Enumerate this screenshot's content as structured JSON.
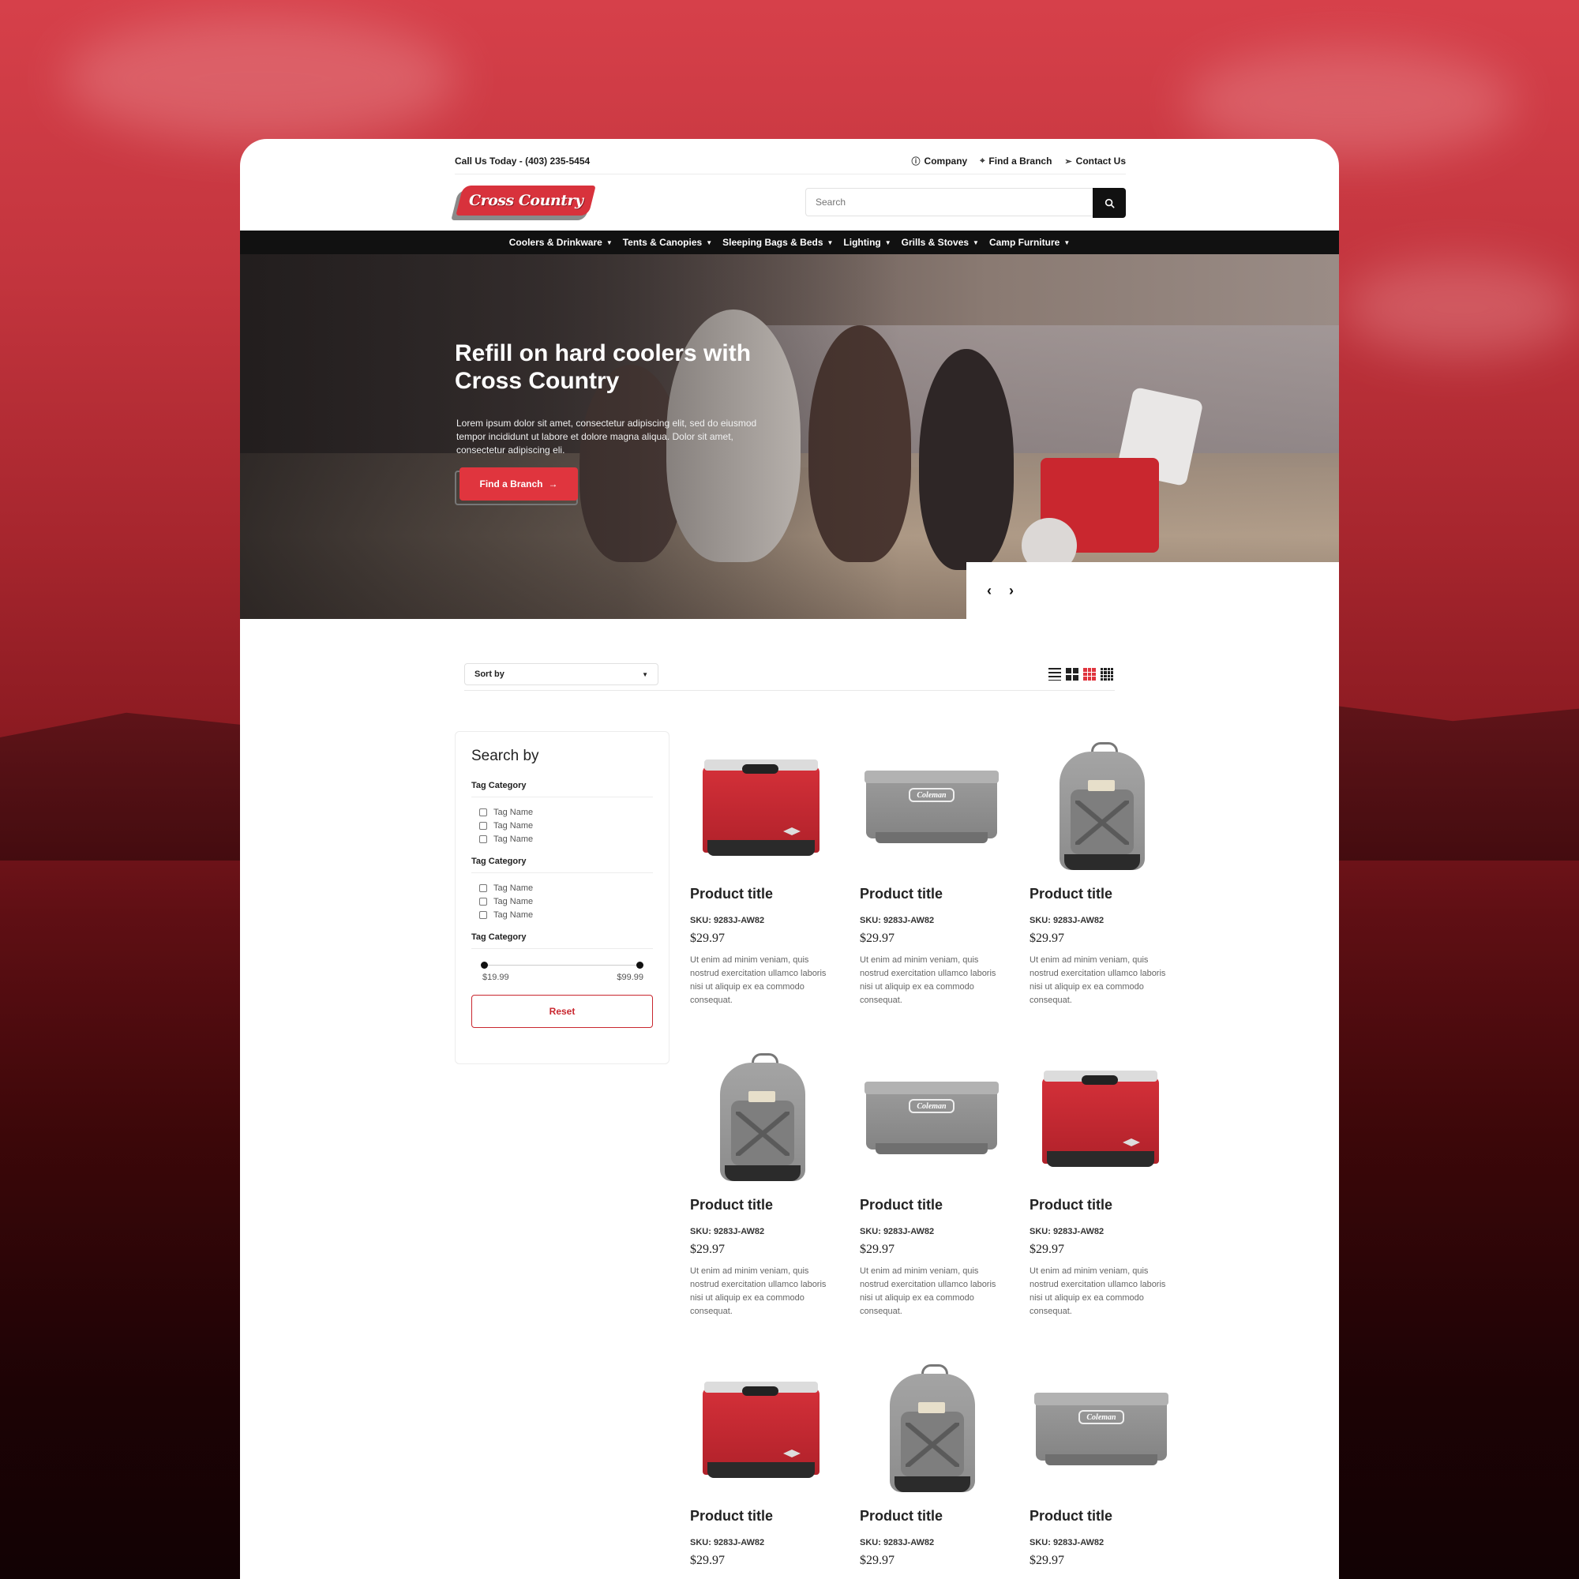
{
  "topbar": {
    "phone": "Call Us Today - (403) 235-5454",
    "links": [
      {
        "icon": "info-icon",
        "label": "Company"
      },
      {
        "icon": "map-pin-icon",
        "label": "Find a Branch"
      },
      {
        "icon": "send-icon",
        "label": "Contact Us"
      }
    ]
  },
  "header": {
    "logo_text": "Cross Country",
    "search_placeholder": "Search",
    "search_icon": "search-icon"
  },
  "nav": {
    "items": [
      "Coolers & Drinkware",
      "Tents & Canopies",
      "Sleeping Bags & Beds",
      "Lighting",
      "Grills & Stoves",
      "Camp Furniture"
    ]
  },
  "hero": {
    "title": "Refill on hard coolers with Cross Country",
    "text": "Lorem ipsum dolor sit amet, consectetur adipiscing elit, sed do eiusmod tempor incididunt ut labore et dolore magna aliqua. Dolor sit amet, consectetur adipiscing eli.",
    "button_label": "Find a Branch",
    "prev_icon": "chevron-left-icon",
    "next_icon": "chevron-right-icon"
  },
  "toolbar": {
    "sort_label": "Sort by",
    "view_modes": [
      "list",
      "grid-2",
      "grid-3",
      "grid-4"
    ],
    "active_view": "grid-3",
    "accent_color": "#e0353e"
  },
  "sidebar": {
    "title": "Search by",
    "groups": [
      {
        "label": "Tag Category",
        "tags": [
          "Tag Name",
          "Tag Name",
          "Tag Name"
        ]
      },
      {
        "label": "Tag Category",
        "tags": [
          "Tag Name",
          "Tag Name",
          "Tag Name"
        ]
      },
      {
        "label": "Tag Category"
      }
    ],
    "price_min": "$19.99",
    "price_max": "$99.99",
    "reset_label": "Reset"
  },
  "products": [
    {
      "image": "red-cooler",
      "title": "Product title",
      "sku": "SKU: 9283J-AW82",
      "price": "$29.97",
      "desc": "Ut enim ad minim veniam, quis nostrud exercitation ullamco laboris nisi ut aliquip ex ea commodo consequat."
    },
    {
      "image": "grey-cooler",
      "title": "Product title",
      "sku": "SKU: 9283J-AW82",
      "price": "$29.97",
      "desc": "Ut enim ad minim veniam, quis nostrud exercitation ullamco laboris nisi ut aliquip ex ea commodo consequat."
    },
    {
      "image": "backpack",
      "title": "Product title",
      "sku": "SKU: 9283J-AW82",
      "price": "$29.97",
      "desc": "Ut enim ad minim veniam, quis nostrud exercitation ullamco laboris nisi ut aliquip ex ea commodo consequat."
    },
    {
      "image": "backpack",
      "title": "Product title",
      "sku": "SKU: 9283J-AW82",
      "price": "$29.97",
      "desc": "Ut enim ad minim veniam, quis nostrud exercitation ullamco laboris nisi ut aliquip ex ea commodo consequat."
    },
    {
      "image": "grey-cooler",
      "title": "Product title",
      "sku": "SKU: 9283J-AW82",
      "price": "$29.97",
      "desc": "Ut enim ad minim veniam, quis nostrud exercitation ullamco laboris nisi ut aliquip ex ea commodo consequat."
    },
    {
      "image": "red-cooler",
      "title": "Product title",
      "sku": "SKU: 9283J-AW82",
      "price": "$29.97",
      "desc": "Ut enim ad minim veniam, quis nostrud exercitation ullamco laboris nisi ut aliquip ex ea commodo consequat."
    },
    {
      "image": "red-cooler",
      "title": "Product title",
      "sku": "SKU: 9283J-AW82",
      "price": "$29.97",
      "desc": ""
    },
    {
      "image": "backpack",
      "title": "Product title",
      "sku": "SKU: 9283J-AW82",
      "price": "$29.97",
      "desc": ""
    },
    {
      "image": "grey-cooler",
      "title": "Product title",
      "sku": "SKU: 9283J-AW82",
      "price": "$29.97",
      "desc": ""
    }
  ],
  "brand_label": "Coleman"
}
